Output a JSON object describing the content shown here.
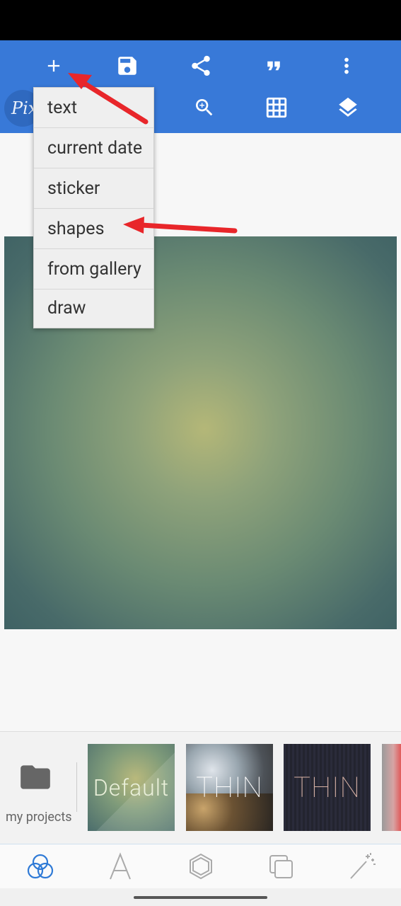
{
  "app": {
    "logo_text": "Pix"
  },
  "toolbar": {
    "row1": [
      "add-icon",
      "save-icon",
      "share-icon",
      "quote-icon",
      "more-vert-icon"
    ],
    "row2": [
      "zoom-in-icon",
      "grid-icon",
      "layers-icon"
    ]
  },
  "add_menu": {
    "items": [
      "text",
      "current date",
      "sticker",
      "shapes",
      "from gallery",
      "draw"
    ]
  },
  "bottom_panel": {
    "projects_label": "my projects",
    "templates": [
      "Default",
      "THIN",
      "THIN"
    ]
  },
  "tabs": [
    "color-circles-icon",
    "text-a-icon",
    "hexagon-icon",
    "layers-copy-icon",
    "magic-wand-icon"
  ],
  "colors": {
    "accent": "#3879d8",
    "annotation_arrow": "#e8262a"
  }
}
